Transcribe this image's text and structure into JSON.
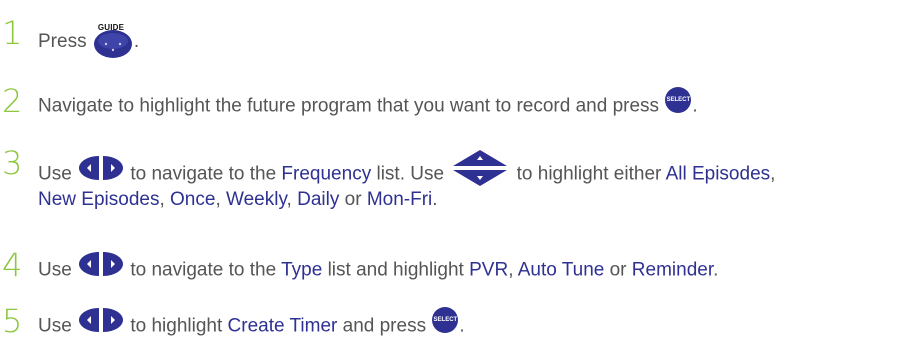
{
  "steps": [
    {
      "number": "1",
      "text_before": "Press",
      "guide_label": "GUIDE",
      "text_after": "."
    },
    {
      "number": "2",
      "text": "Navigate to highlight the future program that you want to record and press",
      "select_label": "SELECT",
      "text_after": "."
    },
    {
      "number": "3",
      "use": "Use",
      "mid1": "to navigate to the",
      "frequency": "Frequency",
      "mid2": "list. Use",
      "mid3": "to highlight either",
      "all_episodes": "All Episodes",
      "comma1": ",",
      "new_episodes": "New Episodes",
      "comma2": ",",
      "once": "Once",
      "comma3": ",",
      "weekly": "Weekly",
      "comma4": ",",
      "daily": "Daily",
      "or": "or",
      "mon_fri": "Mon-Fri",
      "period": "."
    },
    {
      "number": "4",
      "use": "Use",
      "mid1": "to navigate to the",
      "type": "Type",
      "mid2": "list and highlight",
      "pvr": "PVR",
      "comma": ",",
      "auto_tune": "Auto Tune",
      "or": "or",
      "reminder": "Reminder",
      "period": "."
    },
    {
      "number": "5",
      "use": "Use",
      "mid1": "to highlight",
      "create_timer": "Create Timer",
      "mid2": "and press",
      "select_label": "SELECT",
      "period": "."
    }
  ],
  "colors": {
    "step_number": "#8dc63f",
    "highlight": "#2e3192",
    "button": "#2e3192",
    "body_text": "#555555"
  }
}
